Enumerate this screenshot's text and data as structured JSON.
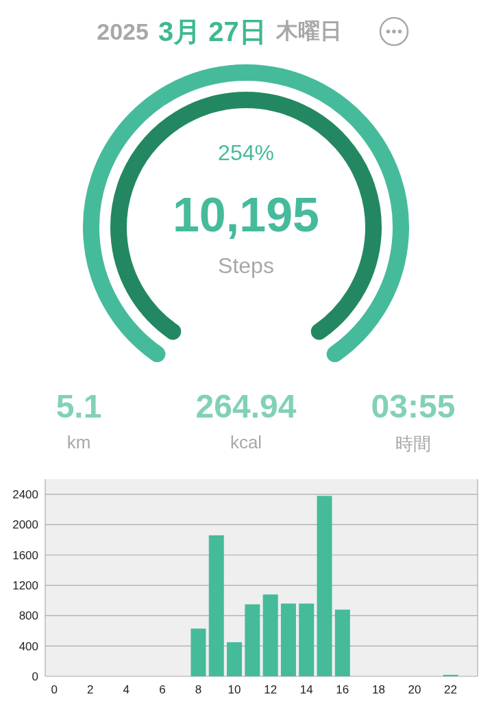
{
  "header": {
    "year": "2025",
    "date": "3月 27日",
    "weekday": "木曜日"
  },
  "gauge": {
    "percent": "254%",
    "steps": "10,195",
    "unit": "Steps"
  },
  "stats": [
    {
      "value": "5.1",
      "unit": "km"
    },
    {
      "value": "264.94",
      "unit": "kcal"
    },
    {
      "value": "03:55",
      "unit": "時間"
    }
  ],
  "hourly": {
    "chart_data": {
      "type": "bar",
      "x": [
        0,
        1,
        2,
        3,
        4,
        5,
        6,
        7,
        8,
        9,
        10,
        11,
        12,
        13,
        14,
        15,
        16,
        17,
        18,
        19,
        20,
        21,
        22,
        23
      ],
      "series": [
        {
          "color": "#45bb9a",
          "values": [
            0,
            0,
            0,
            0,
            0,
            0,
            0,
            0,
            630,
            1860,
            450,
            950,
            1080,
            960,
            960,
            2380,
            880,
            0,
            0,
            0,
            0,
            0,
            20,
            0
          ]
        }
      ],
      "xlim": [
        -0.5,
        23.5
      ],
      "ylim": [
        0,
        2600
      ],
      "yticks": [
        0,
        400,
        800,
        1200,
        1600,
        2000,
        2400
      ],
      "xticks": [
        0,
        2,
        4,
        6,
        8,
        10,
        12,
        14,
        16,
        18,
        20,
        22
      ],
      "grid": true
    }
  }
}
